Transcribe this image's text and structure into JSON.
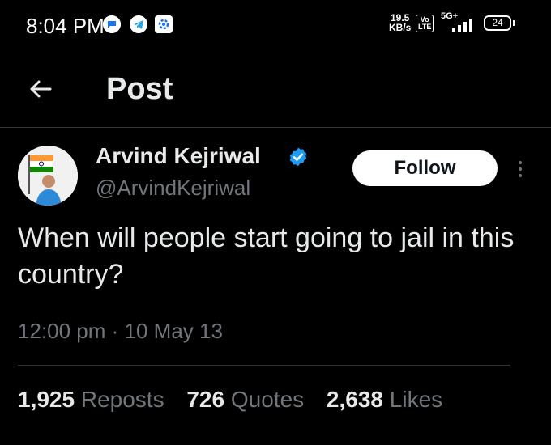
{
  "status_bar": {
    "time": "8:04 PM",
    "net_speed_value": "19.5",
    "net_speed_unit": "KB/s",
    "volte_top": "Vo",
    "volte_bottom": "LTE",
    "network_type": "5G+",
    "battery": "24"
  },
  "header": {
    "title": "Post"
  },
  "tweet": {
    "display_name": "Arvind Kejriwal",
    "handle": "@ArvindKejriwal",
    "follow_label": "Follow",
    "text": "When will people start going to jail in this country?",
    "timestamp": "12:00 pm · 10 May 13"
  },
  "stats": {
    "reposts_count": "1,925",
    "reposts_label": "Reposts",
    "quotes_count": "726",
    "quotes_label": "Quotes",
    "likes_count": "2,638",
    "likes_label": "Likes"
  },
  "colors": {
    "background": "#000000",
    "text_primary": "#e7e9ea",
    "text_secondary": "#71767b",
    "verified": "#1d9bf0",
    "follow_bg": "#ffffff"
  }
}
